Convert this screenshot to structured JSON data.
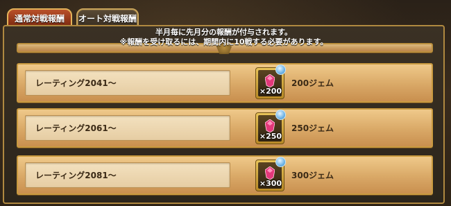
{
  "tabs": {
    "normal_label": "通常対戦報酬",
    "auto_label": "オート対戦報酬"
  },
  "notice": {
    "line1": "半月毎に先月分の報酬が付与されます。",
    "line2": "※報酬を受け取るには、期間内に10戦する必要があります。"
  },
  "rewards": [
    {
      "label": "レーティング2041～",
      "qty": "×200",
      "reward": "200ジェム"
    },
    {
      "label": "レーティング2061～",
      "qty": "×250",
      "reward": "250ジェム"
    },
    {
      "label": "レーティング2081～",
      "qty": "×300",
      "reward": "300ジェム"
    }
  ],
  "colors": {
    "row_bg": "#d9a866",
    "label_bg": "#f3e1bf",
    "gem": "#e3387a",
    "tab_active": "#9a3a18"
  },
  "icons": [
    "gem-icon",
    "water-drop-icon"
  ]
}
